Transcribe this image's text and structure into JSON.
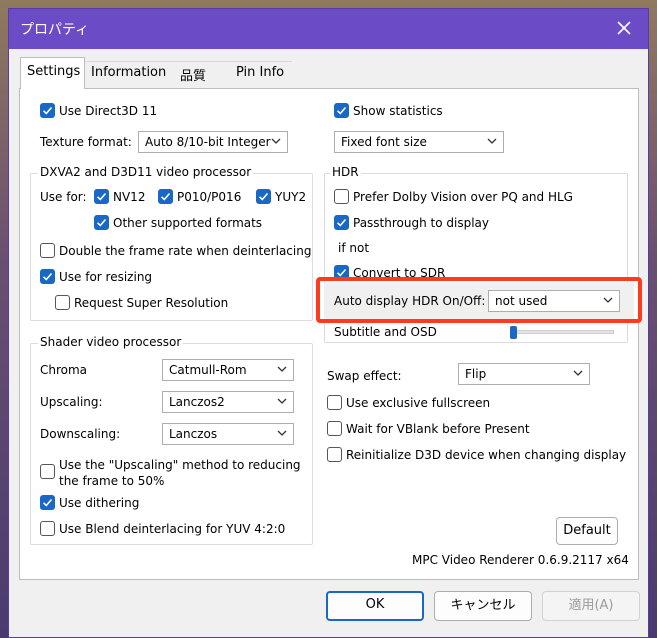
{
  "window": {
    "title": "プロパティ"
  },
  "tabs": [
    {
      "label": "Settings"
    },
    {
      "label": "Information"
    },
    {
      "label": "品質"
    },
    {
      "label": "Pin Info"
    }
  ],
  "left": {
    "use_d3d11": {
      "label": "Use Direct3D 11",
      "checked": true
    },
    "texture_format": {
      "label": "Texture format:",
      "value": "Auto 8/10-bit Integer"
    },
    "dxva_group": {
      "title": "DXVA2 and D3D11 video processor",
      "use_for_label": "Use for:",
      "nv12": {
        "label": "NV12",
        "checked": true
      },
      "p010": {
        "label": "P010/P016",
        "checked": true
      },
      "yuy2": {
        "label": "YUY2",
        "checked": true
      },
      "other": {
        "label": "Other supported formats",
        "checked": true
      },
      "double_frame": {
        "label": "Double the frame rate when deinterlacing",
        "checked": false
      },
      "resizing": {
        "label": "Use for resizing",
        "checked": true
      },
      "super_res": {
        "label": "Request Super Resolution",
        "checked": false
      }
    },
    "shader_group": {
      "title": "Shader video processor",
      "chroma": {
        "label": "Chroma",
        "value": "Catmull-Rom"
      },
      "upscaling": {
        "label": "Upscaling:",
        "value": "Lanczos2"
      },
      "downscaling": {
        "label": "Downscaling:",
        "value": "Lanczos"
      },
      "use_upscaling": {
        "label_line1": "Use the \"Upscaling\" method to reducing",
        "label_line2": "the frame to 50%",
        "checked": false
      },
      "dithering": {
        "label": "Use dithering",
        "checked": true
      },
      "blend": {
        "label": "Use Blend deinterlacing for YUV 4:2:0",
        "checked": false
      }
    }
  },
  "right": {
    "show_stats": {
      "label": "Show statistics",
      "checked": true
    },
    "font_size": {
      "value": "Fixed font size"
    },
    "hdr_group": {
      "title": "HDR",
      "dolby": {
        "label": "Prefer Dolby Vision over PQ and HLG",
        "checked": false
      },
      "passthrough": {
        "label": "Passthrough to display",
        "checked": true
      },
      "if_not": "if not",
      "convert_sdr": {
        "label": "Convert to SDR",
        "checked": true
      },
      "auto_hdr": {
        "label": "Auto display HDR On/Off:",
        "value": "not used"
      },
      "subtitle_osd": {
        "label": "Subtitle and OSD",
        "slider_fraction": 0.0
      }
    },
    "swap_effect": {
      "label": "Swap effect:",
      "value": "Flip"
    },
    "exclusive": {
      "label": "Use exclusive fullscreen",
      "checked": false
    },
    "vblank": {
      "label": "Wait for VBlank before Present",
      "checked": false
    },
    "reinit": {
      "label": "Reinitialize D3D device when changing display",
      "checked": false
    },
    "default_button": "Default",
    "version": "MPC Video Renderer 0.6.9.2117 x64"
  },
  "buttons": {
    "ok": "OK",
    "cancel": "キャンセル",
    "apply": "適用(A)"
  },
  "colors": {
    "accent": "#1a68c5",
    "titlebar": "#6c4cc6",
    "highlight": "#ff3b1f"
  }
}
